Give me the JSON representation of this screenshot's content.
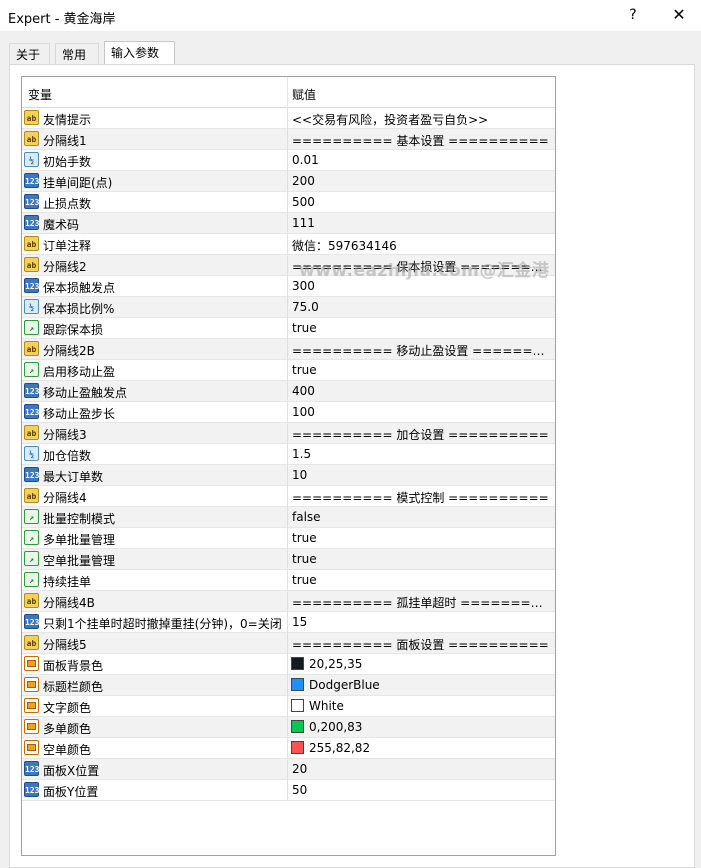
{
  "window": {
    "title": "Expert - 黄金海岸",
    "help": "?",
    "close": "✕"
  },
  "tabs": [
    "关于",
    "常用",
    "输入参数"
  ],
  "table": {
    "col_variable": "变量",
    "col_value": "赋值"
  },
  "watermark": "www.eazhijia.com@汇金港",
  "params": [
    {
      "type": "str",
      "icon": "ab",
      "name": "友情提示",
      "value": "<<交易有风险，投资者盈亏自负>>"
    },
    {
      "type": "str",
      "icon": "ab",
      "name": "分隔线1",
      "value": "========== 基本设置 =========="
    },
    {
      "type": "dbl",
      "icon": "½",
      "name": "初始手数",
      "value": "0.01"
    },
    {
      "type": "int",
      "icon": "123",
      "name": "挂单间距(点)",
      "value": "200"
    },
    {
      "type": "int",
      "icon": "123",
      "name": "止损点数",
      "value": "500"
    },
    {
      "type": "int",
      "icon": "123",
      "name": "魔术码",
      "value": "111"
    },
    {
      "type": "str",
      "icon": "ab",
      "name": "订单注释",
      "value": "微信：597634146"
    },
    {
      "type": "str",
      "icon": "ab",
      "name": "分隔线2",
      "value": "========== 保本损设置 =========="
    },
    {
      "type": "int",
      "icon": "123",
      "name": "保本损触发点",
      "value": "300"
    },
    {
      "type": "dbl",
      "icon": "½",
      "name": "保本损比例%",
      "value": "75.0"
    },
    {
      "type": "bool",
      "icon": "↗",
      "name": "跟踪保本损",
      "value": "true"
    },
    {
      "type": "str",
      "icon": "ab",
      "name": "分隔线2B",
      "value": "========== 移动止盈设置 ========..."
    },
    {
      "type": "bool",
      "icon": "↗",
      "name": "启用移动止盈",
      "value": "true"
    },
    {
      "type": "int",
      "icon": "123",
      "name": "移动止盈触发点",
      "value": "400"
    },
    {
      "type": "int",
      "icon": "123",
      "name": "移动止盈步长",
      "value": "100"
    },
    {
      "type": "str",
      "icon": "ab",
      "name": "分隔线3",
      "value": "========== 加仓设置 =========="
    },
    {
      "type": "dbl",
      "icon": "½",
      "name": "加仓倍数",
      "value": "1.5"
    },
    {
      "type": "int",
      "icon": "123",
      "name": "最大订单数",
      "value": "10"
    },
    {
      "type": "str",
      "icon": "ab",
      "name": "分隔线4",
      "value": "========== 模式控制 =========="
    },
    {
      "type": "bool",
      "icon": "↗",
      "name": "批量控制模式",
      "value": "false"
    },
    {
      "type": "bool",
      "icon": "↗",
      "name": "多单批量管理",
      "value": "true"
    },
    {
      "type": "bool",
      "icon": "↗",
      "name": "空单批量管理",
      "value": "true"
    },
    {
      "type": "bool",
      "icon": "↗",
      "name": "持续挂单",
      "value": "true"
    },
    {
      "type": "str",
      "icon": "ab",
      "name": "分隔线4B",
      "value": "========== 孤挂单超时 =========="
    },
    {
      "type": "int",
      "icon": "123",
      "name": "只剩1个挂单时超时撤掉重挂(分钟)，0=关闭",
      "value": "15"
    },
    {
      "type": "str",
      "icon": "ab",
      "name": "分隔线5",
      "value": "========== 面板设置 =========="
    },
    {
      "type": "clr",
      "icon": "",
      "name": "面板背景色",
      "value": "20,25,35",
      "swatch": "#141923"
    },
    {
      "type": "clr",
      "icon": "",
      "name": "标题栏颜色",
      "value": "DodgerBlue",
      "swatch": "#1e90ff"
    },
    {
      "type": "clr",
      "icon": "",
      "name": "文字颜色",
      "value": "White",
      "swatch": "#ffffff"
    },
    {
      "type": "clr",
      "icon": "",
      "name": "多单颜色",
      "value": "0,200,83",
      "swatch": "#00c853"
    },
    {
      "type": "clr",
      "icon": "",
      "name": "空单颜色",
      "value": "255,82,82",
      "swatch": "#ff5252"
    },
    {
      "type": "int",
      "icon": "123",
      "name": "面板X位置",
      "value": "20"
    },
    {
      "type": "int",
      "icon": "123",
      "name": "面板Y位置",
      "value": "50"
    }
  ]
}
